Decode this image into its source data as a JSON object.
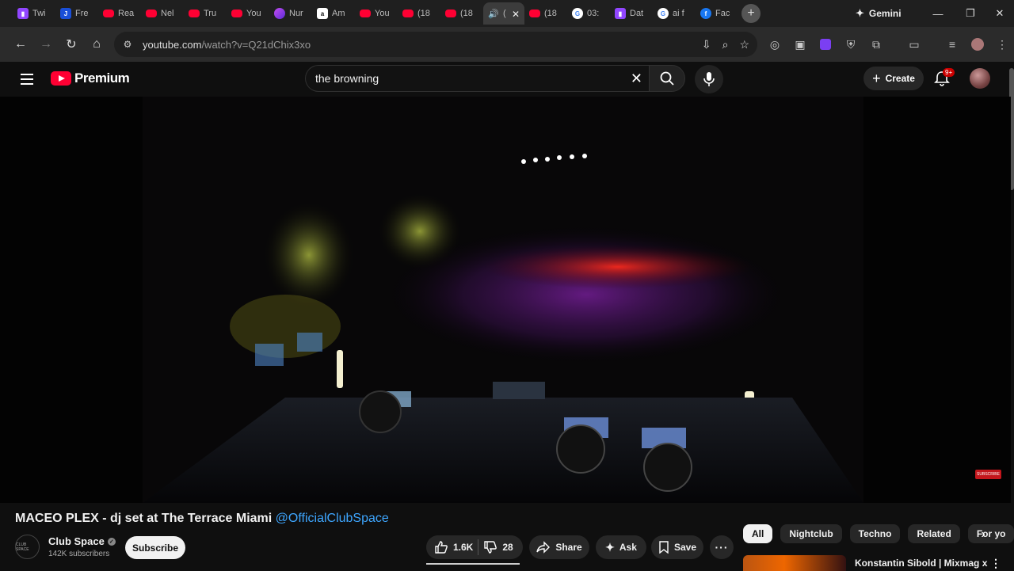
{
  "browser": {
    "tabs": [
      {
        "icon": "twitch-icon",
        "label": "Twi"
      },
      {
        "icon": "j-icon",
        "label": "Fre"
      },
      {
        "icon": "youtube-icon",
        "label": "Rea"
      },
      {
        "icon": "youtube-icon",
        "label": "Nel"
      },
      {
        "icon": "youtube-icon",
        "label": "Tru"
      },
      {
        "icon": "youtube-icon",
        "label": "You"
      },
      {
        "icon": "nu-icon",
        "label": "Nur"
      },
      {
        "icon": "amazon-icon",
        "label": "Am"
      },
      {
        "icon": "youtube-icon",
        "label": "You"
      },
      {
        "icon": "youtube-icon",
        "label": "(18"
      },
      {
        "icon": "youtube-icon",
        "label": "(18"
      },
      {
        "icon": "speaker-icon",
        "label": "(",
        "active": true
      },
      {
        "icon": "youtube-icon",
        "label": "(18"
      },
      {
        "icon": "google-icon",
        "label": "03:"
      },
      {
        "icon": "twitch-icon",
        "label": "Dat"
      },
      {
        "icon": "google-icon",
        "label": "ai f"
      },
      {
        "icon": "facebook-icon",
        "label": "Fac"
      }
    ],
    "gemini_label": "Gemini",
    "url_host": "youtube.com",
    "url_path": "/watch?v=Q21dChix3xo"
  },
  "youtube": {
    "logo_text": "Premium",
    "search_value": "the browning",
    "search_placeholder": "Search",
    "create_label": "Create",
    "notif_badge": "9+"
  },
  "video": {
    "title": "MACEO PLEX - dj set at The Terrace Miami ",
    "title_handle": "@OfficialClubSpace",
    "channel_name": "Club Space",
    "channel_avatar_text": "CLUB SPACE",
    "subscribers": "142K subscribers",
    "subscribe_label": "Subscribe",
    "likes": "1.6K",
    "dislikes": "28",
    "share_label": "Share",
    "ask_label": "Ask",
    "save_label": "Save",
    "watermark": "SUBSCRIBE"
  },
  "sidebar": {
    "chips": [
      "All",
      "Nightclub",
      "Techno",
      "Related",
      "For yo"
    ],
    "first_related_title": "Konstantin Sibold | Mixmag x"
  },
  "colors": {
    "accent_red": "#ff0033",
    "link_blue": "#3ea6ff",
    "background": "#0f0f0f"
  }
}
